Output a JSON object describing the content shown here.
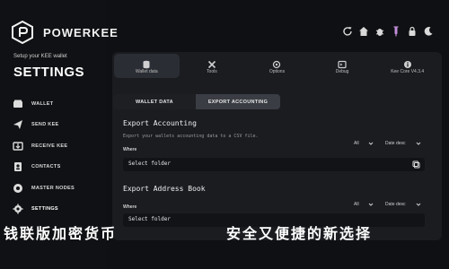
{
  "brand": {
    "name": "POWERKEE"
  },
  "sidebar": {
    "subtitle": "Setup your KEE wallet",
    "title": "SETTINGS",
    "items": [
      {
        "label": "WALLET",
        "icon": "wallet-icon"
      },
      {
        "label": "SEND KEE",
        "icon": "send-icon"
      },
      {
        "label": "RECEIVE KEE",
        "icon": "receive-icon"
      },
      {
        "label": "CONTACTS",
        "icon": "contacts-icon"
      },
      {
        "label": "MASTER NODES",
        "icon": "masternodes-icon"
      },
      {
        "label": "SETTINGS",
        "icon": "settings-icon"
      }
    ]
  },
  "toolbar": {
    "icons": [
      "refresh-icon",
      "home-icon",
      "bug-icon",
      "syringe-icon",
      "lock-icon",
      "moon-icon"
    ]
  },
  "tabs": [
    {
      "label": "Wallet data",
      "icon": "database-icon",
      "active": true
    },
    {
      "label": "Tools",
      "icon": "tools-icon"
    },
    {
      "label": "Options",
      "icon": "options-icon"
    },
    {
      "label": "Debug",
      "icon": "debug-icon"
    },
    {
      "label": "Kee Core V4.3.4",
      "icon": "info-icon"
    }
  ],
  "subtabs": {
    "wallet_data": "WALLET DATA",
    "export_accounting": "EXPORT ACCOUNTING"
  },
  "export_accounting": {
    "title": "Export Accounting",
    "description": "Export your wallets accounting data to a CSV file.",
    "where_label": "Where",
    "filter_all": "All",
    "sort": "Date desc",
    "folder_placeholder": "Select folder"
  },
  "export_address_book": {
    "title": "Export Address Book",
    "where_label": "Where",
    "filter_all": "All",
    "sort": "Date desc",
    "folder_placeholder": "Select folder"
  },
  "banner": {
    "left": "钱联版加密货币",
    "right": "安全又便捷的新选择"
  }
}
